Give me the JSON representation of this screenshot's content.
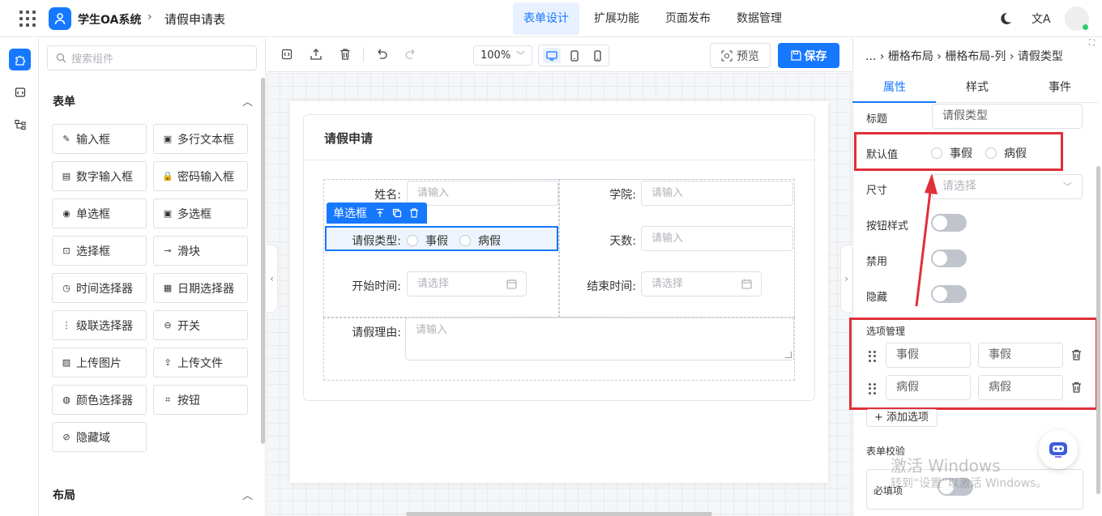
{
  "header": {
    "app_name": "学生OA系统",
    "separator": "›",
    "page_name": "请假申请表",
    "nav": [
      "表单设计",
      "扩展功能",
      "页面发布",
      "数据管理"
    ],
    "active_nav": "表单设计",
    "translate_glyph": "文A"
  },
  "components": {
    "search_placeholder": "搜索组件",
    "form_section_title": "表单",
    "layout_section_title": "布局",
    "items": [
      {
        "label": "输入框",
        "icon": "pencil-icon"
      },
      {
        "label": "多行文本框",
        "icon": "textarea-icon"
      },
      {
        "label": "数字输入框",
        "icon": "number-icon"
      },
      {
        "label": "密码输入框",
        "icon": "lock-icon"
      },
      {
        "label": "单选框",
        "icon": "radio-icon"
      },
      {
        "label": "多选框",
        "icon": "checkbox-icon"
      },
      {
        "label": "选择框",
        "icon": "select-icon"
      },
      {
        "label": "滑块",
        "icon": "slider-icon"
      },
      {
        "label": "时间选择器",
        "icon": "clock-icon"
      },
      {
        "label": "日期选择器",
        "icon": "calendar-icon"
      },
      {
        "label": "级联选择器",
        "icon": "cascader-icon"
      },
      {
        "label": "开关",
        "icon": "switch-icon"
      },
      {
        "label": "上传图片",
        "icon": "image-icon"
      },
      {
        "label": "上传文件",
        "icon": "upload-icon"
      },
      {
        "label": "颜色选择器",
        "icon": "palette-icon"
      },
      {
        "label": "按钮",
        "icon": "button-icon"
      },
      {
        "label": "隐藏域",
        "icon": "eye-off-icon"
      }
    ]
  },
  "toolbar": {
    "zoom": "100%",
    "preview_label": "预览",
    "save_label": "保存"
  },
  "form": {
    "title": "请假申请",
    "name_label": "姓名:",
    "name_placeholder": "请输入",
    "college_label": "学院:",
    "college_placeholder": "请输入",
    "selected_tag": "单选框",
    "leave_type_label": "请假类型:",
    "leave_options": [
      "事假",
      "病假"
    ],
    "days_label": "天数:",
    "days_placeholder": "请输入",
    "start_label": "开始时间:",
    "start_placeholder": "请选择",
    "end_label": "结束时间:",
    "end_placeholder": "请选择",
    "reason_label": "请假理由:",
    "reason_placeholder": "请输入"
  },
  "props": {
    "breadcrumb": "... › 栅格布局 › 栅格布局-列 › 请假类型",
    "tabs": [
      "属性",
      "样式",
      "事件"
    ],
    "active_tab": "属性",
    "title_label": "标题",
    "title_value": "请假类型",
    "default_label": "默认值",
    "default_options": [
      "事假",
      "病假"
    ],
    "size_label": "尺寸",
    "size_placeholder": "请选择",
    "button_style_label": "按钮样式",
    "button_style_on": false,
    "disabled_label": "禁用",
    "disabled_on": false,
    "hidden_label": "隐藏",
    "hidden_on": false,
    "options_label": "选项管理",
    "options": [
      {
        "label": "事假",
        "value": "事假"
      },
      {
        "label": "病假",
        "value": "病假"
      }
    ],
    "add_option_label": "+ 添加选项",
    "validation_label": "表单校验",
    "required_label": "必填项",
    "required_on": false
  },
  "watermark": {
    "line1": "激活 Windows",
    "line2": "转到“设置”以激活 Windows。"
  },
  "colors": {
    "accent": "#1677ff",
    "highlight": "#e0303a"
  }
}
